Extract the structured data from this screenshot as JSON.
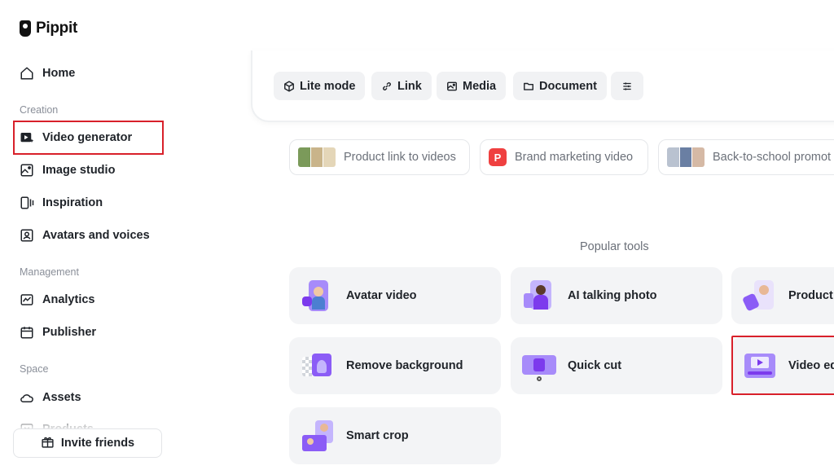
{
  "app": {
    "name": "Pippit"
  },
  "sidebar": {
    "items": [
      {
        "label": "Home",
        "icon": "home-icon"
      },
      {
        "section": "Creation"
      },
      {
        "label": "Video generator",
        "icon": "video-generator-icon",
        "highlighted": true
      },
      {
        "label": "Image studio",
        "icon": "image-studio-icon"
      },
      {
        "label": "Inspiration",
        "icon": "inspiration-icon"
      },
      {
        "label": "Avatars and voices",
        "icon": "avatar-icon"
      },
      {
        "section": "Management"
      },
      {
        "label": "Analytics",
        "icon": "analytics-icon"
      },
      {
        "label": "Publisher",
        "icon": "calendar-icon"
      },
      {
        "section": "Space"
      },
      {
        "label": "Assets",
        "icon": "cloud-icon"
      },
      {
        "label": "Products",
        "icon": "products-icon"
      }
    ],
    "labels": {
      "home": "Home",
      "creation": "Creation",
      "video_generator": "Video generator",
      "image_studio": "Image studio",
      "inspiration": "Inspiration",
      "avatars": "Avatars and voices",
      "management": "Management",
      "analytics": "Analytics",
      "publisher": "Publisher",
      "space": "Space",
      "assets": "Assets",
      "products": "Products"
    },
    "invite": "Invite friends"
  },
  "prompt": {
    "chips": {
      "lite": "Lite mode",
      "link": "Link",
      "media": "Media",
      "document": "Document"
    }
  },
  "suggestions": {
    "product_link": "Product link to videos",
    "brand": "Brand marketing video",
    "brand_badge": "P",
    "school": "Back-to-school promot"
  },
  "popular": {
    "title": "Popular tools",
    "avatar_video": "Avatar video",
    "ai_talking": "AI talking photo",
    "product": "Product",
    "remove_bg": "Remove background",
    "quick_cut": "Quick cut",
    "video_ed": "Video ed",
    "smart_crop": "Smart crop"
  },
  "colors": {
    "accent_purple": "#8b5cf6",
    "highlight_red": "#d8202a",
    "card_bg": "#f3f4f6"
  }
}
